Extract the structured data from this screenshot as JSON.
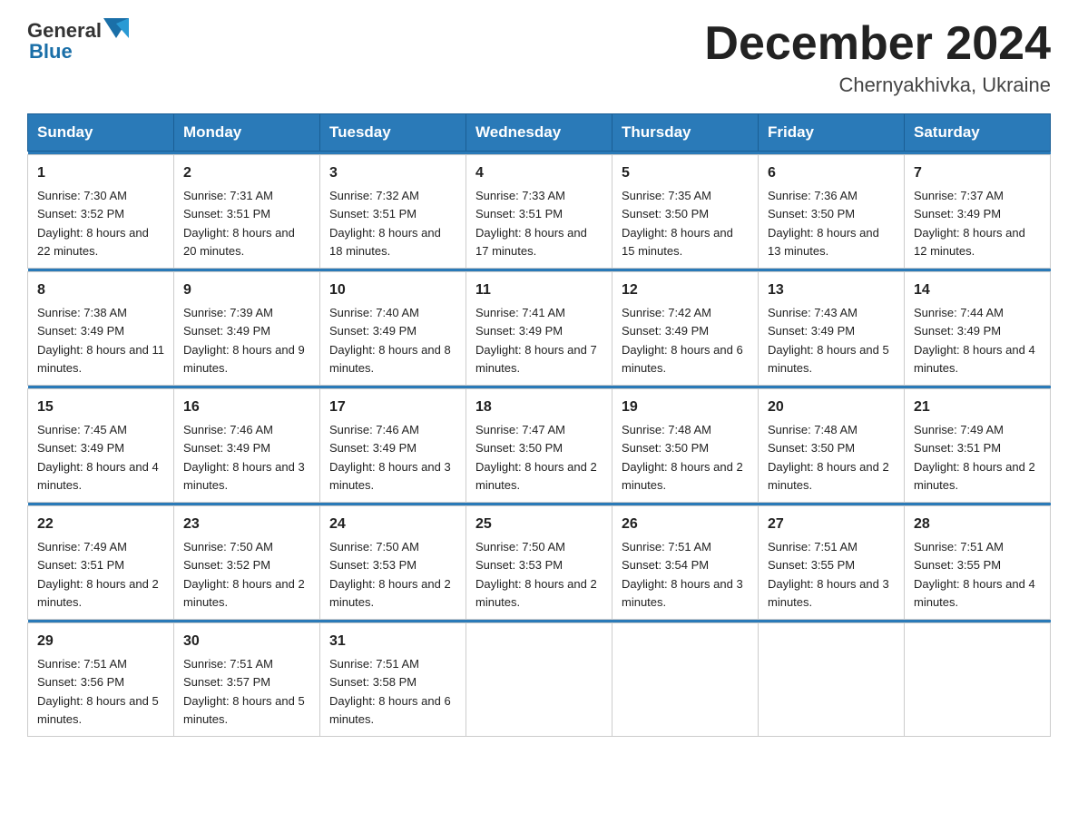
{
  "header": {
    "logo_general": "General",
    "logo_blue": "Blue",
    "month_title": "December 2024",
    "location": "Chernyakhivka, Ukraine"
  },
  "days_of_week": [
    "Sunday",
    "Monday",
    "Tuesday",
    "Wednesday",
    "Thursday",
    "Friday",
    "Saturday"
  ],
  "weeks": [
    [
      {
        "num": "1",
        "sunrise": "7:30 AM",
        "sunset": "3:52 PM",
        "daylight": "8 hours and 22 minutes."
      },
      {
        "num": "2",
        "sunrise": "7:31 AM",
        "sunset": "3:51 PM",
        "daylight": "8 hours and 20 minutes."
      },
      {
        "num": "3",
        "sunrise": "7:32 AM",
        "sunset": "3:51 PM",
        "daylight": "8 hours and 18 minutes."
      },
      {
        "num": "4",
        "sunrise": "7:33 AM",
        "sunset": "3:51 PM",
        "daylight": "8 hours and 17 minutes."
      },
      {
        "num": "5",
        "sunrise": "7:35 AM",
        "sunset": "3:50 PM",
        "daylight": "8 hours and 15 minutes."
      },
      {
        "num": "6",
        "sunrise": "7:36 AM",
        "sunset": "3:50 PM",
        "daylight": "8 hours and 13 minutes."
      },
      {
        "num": "7",
        "sunrise": "7:37 AM",
        "sunset": "3:49 PM",
        "daylight": "8 hours and 12 minutes."
      }
    ],
    [
      {
        "num": "8",
        "sunrise": "7:38 AM",
        "sunset": "3:49 PM",
        "daylight": "8 hours and 11 minutes."
      },
      {
        "num": "9",
        "sunrise": "7:39 AM",
        "sunset": "3:49 PM",
        "daylight": "8 hours and 9 minutes."
      },
      {
        "num": "10",
        "sunrise": "7:40 AM",
        "sunset": "3:49 PM",
        "daylight": "8 hours and 8 minutes."
      },
      {
        "num": "11",
        "sunrise": "7:41 AM",
        "sunset": "3:49 PM",
        "daylight": "8 hours and 7 minutes."
      },
      {
        "num": "12",
        "sunrise": "7:42 AM",
        "sunset": "3:49 PM",
        "daylight": "8 hours and 6 minutes."
      },
      {
        "num": "13",
        "sunrise": "7:43 AM",
        "sunset": "3:49 PM",
        "daylight": "8 hours and 5 minutes."
      },
      {
        "num": "14",
        "sunrise": "7:44 AM",
        "sunset": "3:49 PM",
        "daylight": "8 hours and 4 minutes."
      }
    ],
    [
      {
        "num": "15",
        "sunrise": "7:45 AM",
        "sunset": "3:49 PM",
        "daylight": "8 hours and 4 minutes."
      },
      {
        "num": "16",
        "sunrise": "7:46 AM",
        "sunset": "3:49 PM",
        "daylight": "8 hours and 3 minutes."
      },
      {
        "num": "17",
        "sunrise": "7:46 AM",
        "sunset": "3:49 PM",
        "daylight": "8 hours and 3 minutes."
      },
      {
        "num": "18",
        "sunrise": "7:47 AM",
        "sunset": "3:50 PM",
        "daylight": "8 hours and 2 minutes."
      },
      {
        "num": "19",
        "sunrise": "7:48 AM",
        "sunset": "3:50 PM",
        "daylight": "8 hours and 2 minutes."
      },
      {
        "num": "20",
        "sunrise": "7:48 AM",
        "sunset": "3:50 PM",
        "daylight": "8 hours and 2 minutes."
      },
      {
        "num": "21",
        "sunrise": "7:49 AM",
        "sunset": "3:51 PM",
        "daylight": "8 hours and 2 minutes."
      }
    ],
    [
      {
        "num": "22",
        "sunrise": "7:49 AM",
        "sunset": "3:51 PM",
        "daylight": "8 hours and 2 minutes."
      },
      {
        "num": "23",
        "sunrise": "7:50 AM",
        "sunset": "3:52 PM",
        "daylight": "8 hours and 2 minutes."
      },
      {
        "num": "24",
        "sunrise": "7:50 AM",
        "sunset": "3:53 PM",
        "daylight": "8 hours and 2 minutes."
      },
      {
        "num": "25",
        "sunrise": "7:50 AM",
        "sunset": "3:53 PM",
        "daylight": "8 hours and 2 minutes."
      },
      {
        "num": "26",
        "sunrise": "7:51 AM",
        "sunset": "3:54 PM",
        "daylight": "8 hours and 3 minutes."
      },
      {
        "num": "27",
        "sunrise": "7:51 AM",
        "sunset": "3:55 PM",
        "daylight": "8 hours and 3 minutes."
      },
      {
        "num": "28",
        "sunrise": "7:51 AM",
        "sunset": "3:55 PM",
        "daylight": "8 hours and 4 minutes."
      }
    ],
    [
      {
        "num": "29",
        "sunrise": "7:51 AM",
        "sunset": "3:56 PM",
        "daylight": "8 hours and 5 minutes."
      },
      {
        "num": "30",
        "sunrise": "7:51 AM",
        "sunset": "3:57 PM",
        "daylight": "8 hours and 5 minutes."
      },
      {
        "num": "31",
        "sunrise": "7:51 AM",
        "sunset": "3:58 PM",
        "daylight": "8 hours and 6 minutes."
      },
      null,
      null,
      null,
      null
    ]
  ]
}
